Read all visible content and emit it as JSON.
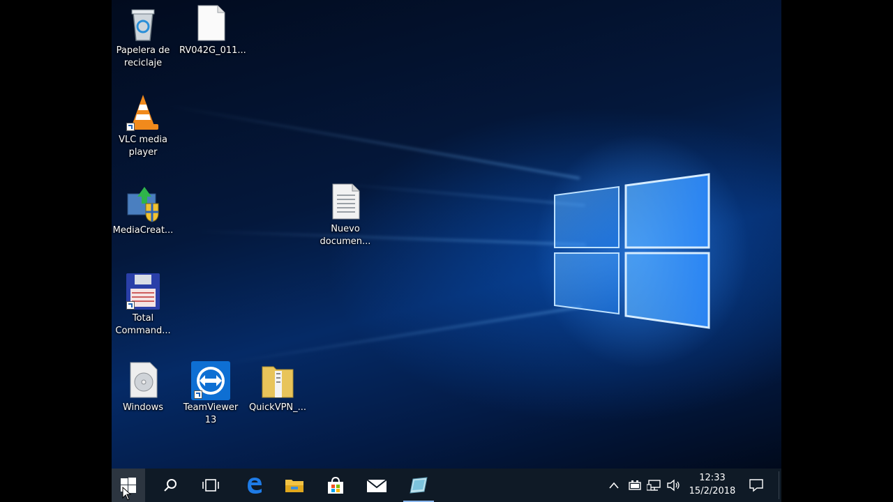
{
  "desktop": {
    "icons": [
      {
        "name": "recycle-bin",
        "label": "Papelera de\nreciclaje",
        "icon": "recycle-bin-icon"
      },
      {
        "name": "rv042g-file",
        "label": "RV042G_011...",
        "icon": "blank-file-icon"
      },
      {
        "name": "vlc-media-player",
        "label": "VLC media\nplayer",
        "icon": "vlc-icon"
      },
      {
        "name": "media-creation-tool",
        "label": "MediaCreat...",
        "icon": "media-creation-icon"
      },
      {
        "name": "nuevo-documento",
        "label": "Nuevo\ndocumen...",
        "icon": "text-document-icon"
      },
      {
        "name": "total-commander",
        "label": "Total\nCommand...",
        "icon": "total-commander-icon"
      },
      {
        "name": "windows-iso",
        "label": "Windows",
        "icon": "disc-image-icon"
      },
      {
        "name": "teamviewer-13",
        "label": "TeamViewer\n13",
        "icon": "teamviewer-icon"
      },
      {
        "name": "quickvpn-folder",
        "label": "QuickVPN_...",
        "icon": "zip-folder-icon"
      }
    ]
  },
  "taskbar": {
    "start": "windows-logo-icon",
    "pinned": [
      "search-icon",
      "task-view-icon",
      "edge-icon",
      "file-explorer-icon",
      "store-icon",
      "mail-icon",
      "active-app-icon"
    ],
    "tray": [
      "chevron-up-icon",
      "battery-icon",
      "network-icon",
      "volume-icon"
    ],
    "clock": {
      "time": "12:33",
      "date": "15/2/2018"
    },
    "action_center": "notification-icon"
  },
  "colors": {
    "taskbar_bg": "#0f1a26",
    "accent": "#0078d7",
    "wallpaper_glow": "#3c96ff"
  }
}
